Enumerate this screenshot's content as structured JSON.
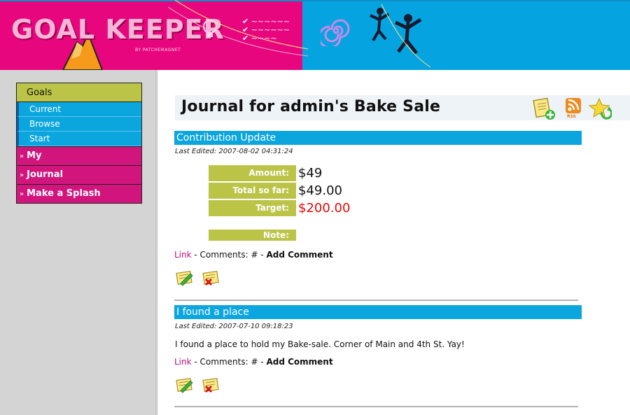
{
  "header": {
    "logo_text": "GOAL KEEPER",
    "logo_sub": "BY PATCHEMAGNET"
  },
  "sidebar": {
    "section": "Goals",
    "sub_items": [
      "Current",
      "Browse",
      "Start"
    ],
    "items": [
      "My",
      "Journal",
      "Make a Splash"
    ],
    "arrow": "»"
  },
  "main": {
    "title": "Journal for admin's Bake Sale",
    "toolbar": {
      "rss_label": "RSS"
    },
    "entries": [
      {
        "heading": "Contribution Update",
        "edited": "Last Edited: 2007-08-02 04:31:24",
        "fields": [
          {
            "label": "Amount:",
            "value": "$49"
          },
          {
            "label": "Total so far:",
            "value": "$49.00"
          },
          {
            "label": "Target:",
            "value": "$200.00"
          }
        ],
        "note_label": "Note:",
        "link": "Link",
        "comments": " - Comments: # - ",
        "add_comment": "Add Comment"
      },
      {
        "heading": "I found a place",
        "edited": "Last Edited: 2007-07-10 09:18:23",
        "body": "I found a place to hold my Bake-sale. Corner of Main and 4th St. Yay!",
        "link": "Link",
        "comments": " - Comments: # - ",
        "add_comment": "Add Comment"
      }
    ]
  },
  "colors": {
    "pink": "#d2157d",
    "blue": "#0ca6df",
    "olive": "#bcc448",
    "red": "#e20a0a"
  }
}
